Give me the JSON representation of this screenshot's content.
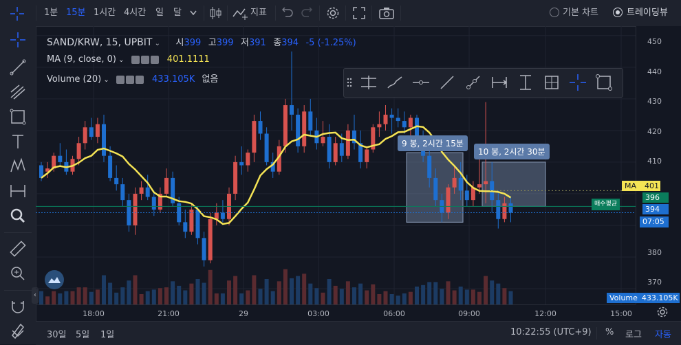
{
  "toolbar": {
    "intervals": [
      "1분",
      "15분",
      "1시간",
      "4시간",
      "일",
      "달"
    ],
    "active_interval": "15분",
    "indicator_label": "지표",
    "chart_modes": [
      "기본 차트",
      "트레이딩뷰"
    ],
    "selected_mode": "트레이딩뷰"
  },
  "legend": {
    "symbol": "SAND/KRW, 15, UPBIT",
    "ohlc_labels": [
      "시",
      "고",
      "저",
      "종"
    ],
    "ohlc_values": [
      "399",
      "399",
      "391",
      "394"
    ],
    "change": "-5 (-1.25%)",
    "ma_label": "MA (9, close, 0)",
    "ma_value": "401.1111",
    "volume_label": "Volume (20)",
    "volume_value": "433.105K",
    "volume_extra": "없음"
  },
  "price_axis": {
    "labels": [
      "450",
      "440",
      "430",
      "420",
      "410",
      "380",
      "370"
    ],
    "ma_tag_label": "MA",
    "ma_tag_value": "401",
    "price_396": "396",
    "price_394": "394",
    "countdown": "07:05",
    "avg_buy_label": "매수평균",
    "volume_tag_label": "Volume",
    "volume_tag_value": "433.105K"
  },
  "time_axis": [
    "18:00",
    "21:00",
    "29",
    "03:00",
    "06:00",
    "09:00",
    "12:00",
    "15:00"
  ],
  "tooltips": [
    "9 봉, 2시간 15분",
    "10 봉, 2시간 30분"
  ],
  "bottom": {
    "ranges": [
      "30일",
      "5일",
      "1일"
    ],
    "clock": "10:22:55 (UTC+9)",
    "percent": "%",
    "log": "로그",
    "auto": "자동"
  },
  "colors": {
    "up": "#d8534f",
    "down": "#1e6fd0",
    "ma": "#f5e455",
    "accent": "#2962ff",
    "avg_buy": "#0a7d5c"
  },
  "chart_data": {
    "type": "candlestick",
    "title": "SAND/KRW, 15, UPBIT",
    "ylim": [
      365,
      453
    ],
    "x_ticks": [
      "18:00",
      "21:00",
      "29",
      "03:00",
      "06:00",
      "09:00",
      "12:00",
      "15:00"
    ],
    "candles": [
      [
        409,
        410,
        404,
        405
      ],
      [
        407,
        410,
        405,
        408
      ],
      [
        408,
        413,
        407,
        412
      ],
      [
        412,
        416,
        409,
        410
      ],
      [
        410,
        414,
        406,
        407
      ],
      [
        407,
        412,
        406,
        411
      ],
      [
        411,
        418,
        409,
        416
      ],
      [
        416,
        423,
        414,
        421
      ],
      [
        421,
        424,
        417,
        418
      ],
      [
        418,
        424,
        416,
        422
      ],
      [
        422,
        425,
        410,
        412
      ],
      [
        412,
        415,
        404,
        405
      ],
      [
        405,
        409,
        401,
        403
      ],
      [
        403,
        405,
        396,
        398
      ],
      [
        398,
        400,
        388,
        390
      ],
      [
        390,
        402,
        387,
        400
      ],
      [
        400,
        404,
        398,
        402
      ],
      [
        402,
        406,
        398,
        399
      ],
      [
        399,
        401,
        393,
        395
      ],
      [
        395,
        402,
        394,
        400
      ],
      [
        400,
        408,
        399,
        405
      ],
      [
        405,
        407,
        396,
        397
      ],
      [
        397,
        399,
        390,
        391
      ],
      [
        391,
        395,
        386,
        388
      ],
      [
        388,
        397,
        387,
        395
      ],
      [
        395,
        396,
        384,
        386
      ],
      [
        386,
        388,
        377,
        379
      ],
      [
        379,
        394,
        378,
        392
      ],
      [
        392,
        397,
        390,
        394
      ],
      [
        394,
        398,
        391,
        392
      ],
      [
        392,
        402,
        390,
        400
      ],
      [
        400,
        412,
        398,
        410
      ],
      [
        410,
        415,
        406,
        409
      ],
      [
        409,
        414,
        407,
        413
      ],
      [
        413,
        425,
        410,
        423
      ],
      [
        423,
        426,
        417,
        419
      ],
      [
        419,
        421,
        409,
        410
      ],
      [
        410,
        413,
        405,
        407
      ],
      [
        407,
        417,
        406,
        415
      ],
      [
        415,
        430,
        413,
        428
      ],
      [
        428,
        445,
        420,
        425
      ],
      [
        425,
        427,
        413,
        415
      ],
      [
        415,
        428,
        413,
        426
      ],
      [
        426,
        430,
        418,
        420
      ],
      [
        420,
        424,
        414,
        416
      ],
      [
        416,
        423,
        415,
        418
      ],
      [
        418,
        422,
        408,
        410
      ],
      [
        410,
        418,
        409,
        416
      ],
      [
        416,
        419,
        410,
        412
      ],
      [
        412,
        422,
        411,
        420
      ],
      [
        420,
        425,
        414,
        416
      ],
      [
        416,
        420,
        408,
        410
      ],
      [
        410,
        415,
        408,
        414
      ],
      [
        414,
        422,
        413,
        421
      ],
      [
        421,
        426,
        418,
        422
      ],
      [
        422,
        428,
        420,
        425
      ],
      [
        425,
        427,
        419,
        424
      ],
      [
        424,
        427,
        421,
        423
      ],
      [
        423,
        426,
        419,
        421
      ],
      [
        421,
        425,
        418,
        424
      ],
      [
        424,
        425,
        417,
        418
      ],
      [
        418,
        420,
        410,
        412
      ],
      [
        412,
        414,
        402,
        405
      ],
      [
        405,
        408,
        396,
        398
      ],
      [
        398,
        400,
        391,
        394
      ],
      [
        394,
        403,
        392,
        402
      ],
      [
        402,
        409,
        400,
        405
      ],
      [
        405,
        410,
        398,
        401
      ],
      [
        401,
        406,
        396,
        398
      ],
      [
        398,
        404,
        396,
        402
      ],
      [
        402,
        411,
        400,
        403
      ],
      [
        403,
        429,
        397,
        404
      ],
      [
        404,
        410,
        394,
        398
      ],
      [
        398,
        401,
        389,
        392
      ],
      [
        392,
        399,
        391,
        397
      ],
      [
        397,
        399,
        391,
        394
      ]
    ],
    "ma_value": 401.1111,
    "volume_last": "433.105K"
  }
}
